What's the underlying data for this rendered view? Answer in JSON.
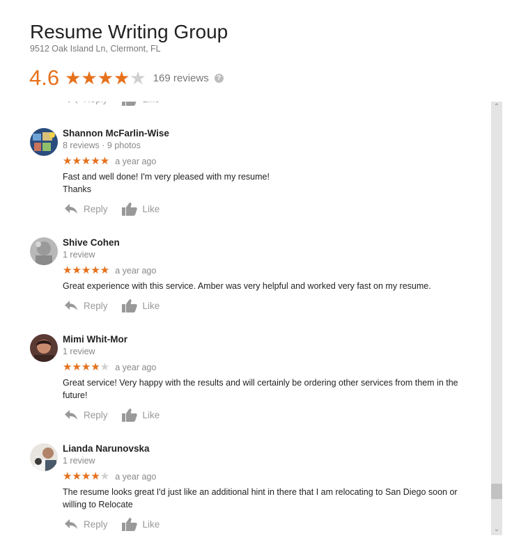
{
  "place": {
    "name": "Resume Writing Group",
    "address": "9512 Oak Island Ln, Clermont, FL",
    "rating": "4.6",
    "rating_fraction": 0.82,
    "review_count": "169 reviews",
    "help_glyph": "?"
  },
  "labels": {
    "reply": "Reply",
    "like": "Like"
  },
  "colors": {
    "star": "#e7711b",
    "star_empty": "#d0d0d0",
    "muted": "#999999",
    "scrollbar": "#e4e4e4"
  },
  "icons": {
    "reply": "reply-icon",
    "like": "thumbs-up-icon",
    "help": "help-icon"
  },
  "reviews": [
    {
      "name": "Shannon McFarlin-Wise",
      "meta": "8 reviews · 9 photos",
      "stars": 5,
      "age": "a year ago",
      "text_lines": [
        "Fast and well done! I'm very pleased with my resume!",
        "Thanks"
      ]
    },
    {
      "name": "Shive Cohen",
      "meta": "1 review",
      "stars": 5,
      "age": "a year ago",
      "text_lines": [
        "Great experience with this service. Amber was very helpful and worked very fast on my resume."
      ]
    },
    {
      "name": "Mimi Whit-Mor",
      "meta": "1 review",
      "stars": 4,
      "age": "a year ago",
      "text_lines": [
        "Great service! Very happy with the results and will certainly be ordering other services from them in the",
        "future!"
      ]
    },
    {
      "name": "Lianda Narunovska",
      "meta": "1 review",
      "stars": 4,
      "age": "a year ago",
      "text_lines": [
        "The resume looks great I'd just like an additional hint in there that I am relocating to San Diego soon or",
        "willing to Relocate"
      ]
    }
  ],
  "scroll": {
    "up_glyph": "⌃",
    "down_glyph": "⌄",
    "position_fraction": 0.9
  }
}
